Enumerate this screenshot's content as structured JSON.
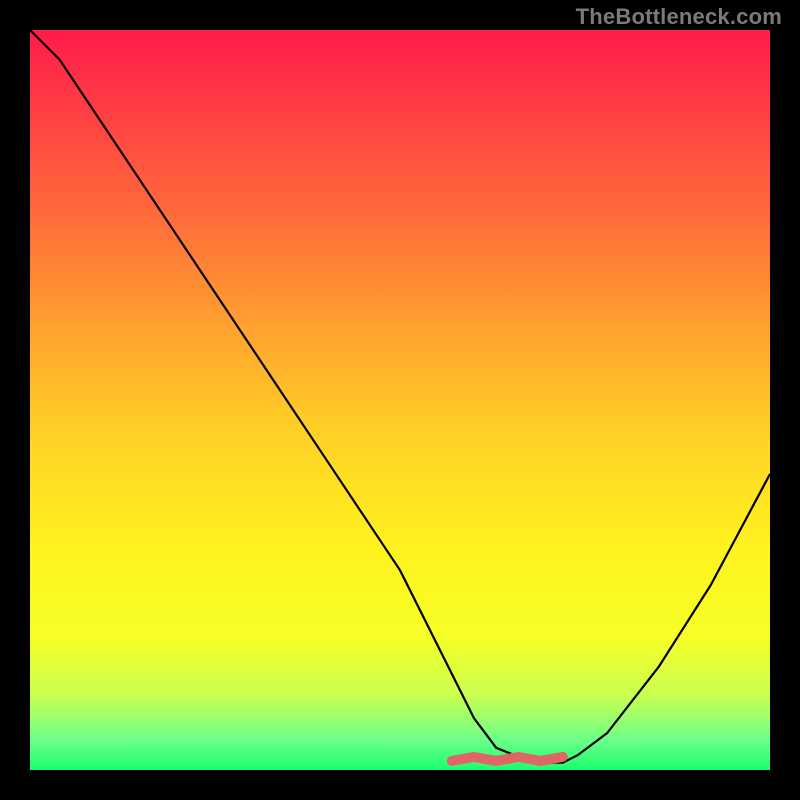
{
  "watermark": "TheBottleneck.com",
  "chart_data": {
    "type": "line",
    "title": "",
    "xlabel": "",
    "ylabel": "",
    "xlim": [
      0,
      100
    ],
    "ylim": [
      0,
      100
    ],
    "series": [
      {
        "name": "bottleneck-curve",
        "x": [
          0,
          4,
          10,
          20,
          30,
          40,
          50,
          57,
          60,
          63,
          68,
          72,
          74,
          78,
          85,
          92,
          100
        ],
        "values": [
          100,
          96,
          87,
          72,
          57,
          42,
          27,
          13,
          7,
          3,
          1,
          1,
          2,
          5,
          14,
          25,
          40
        ]
      }
    ],
    "annotations": [
      {
        "name": "flat-minimum-highlight",
        "x_start": 57,
        "x_end": 72,
        "y": 1.5
      }
    ],
    "gradient_stops": [
      {
        "pct": 0,
        "color": "#ff1c4a"
      },
      {
        "pct": 25,
        "color": "#ff6b3a"
      },
      {
        "pct": 55,
        "color": "#ffd225"
      },
      {
        "pct": 82,
        "color": "#f7ff26"
      },
      {
        "pct": 100,
        "color": "#1aff6b"
      }
    ]
  }
}
